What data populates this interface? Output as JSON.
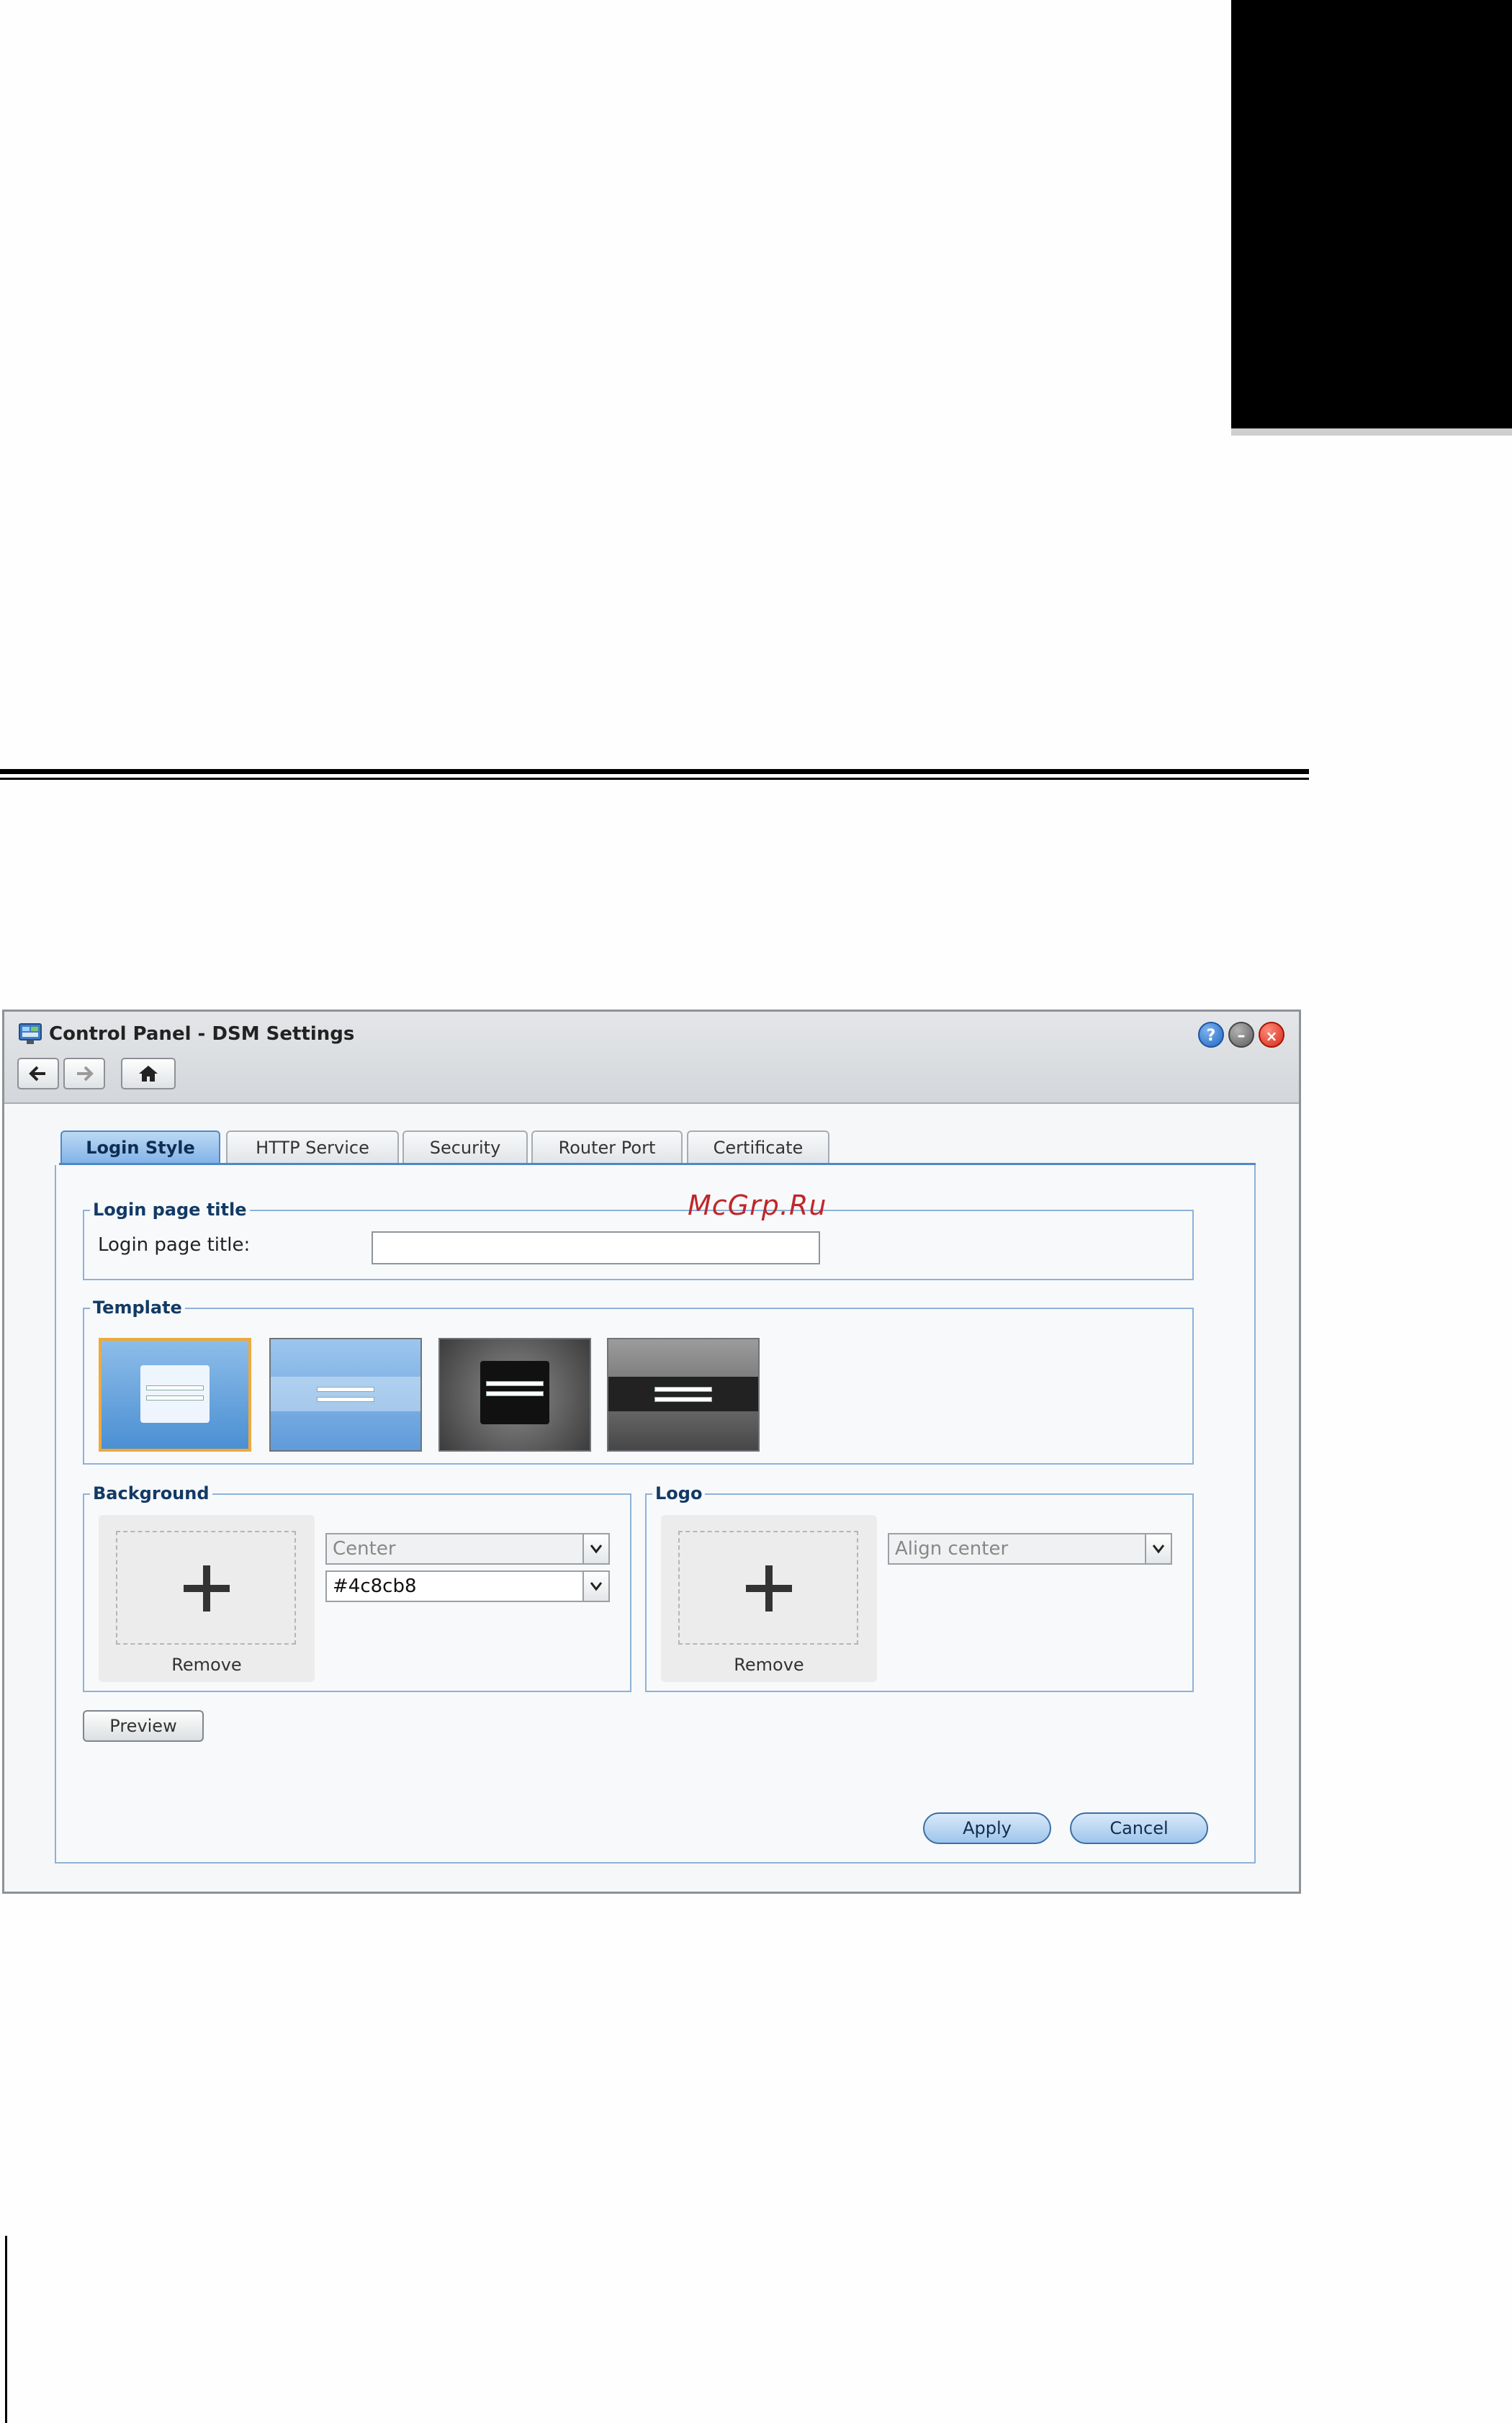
{
  "window": {
    "title": "Control Panel - DSM Settings",
    "controls": {
      "help": "?",
      "minimize": "–",
      "close": "×"
    }
  },
  "tabs": [
    {
      "label": "Login Style",
      "active": true
    },
    {
      "label": "HTTP Service",
      "active": false
    },
    {
      "label": "Security",
      "active": false
    },
    {
      "label": "Router Port",
      "active": false
    },
    {
      "label": "Certificate",
      "active": false
    }
  ],
  "watermark": "McGrp.Ru",
  "login_title": {
    "legend": "Login page title",
    "field_label": "Login page title:",
    "value": ""
  },
  "template": {
    "legend": "Template",
    "selected_index": 0
  },
  "background": {
    "legend": "Background",
    "remove_label": "Remove",
    "position_value": "Center",
    "color_value": "#4c8cb8"
  },
  "logo": {
    "legend": "Logo",
    "remove_label": "Remove",
    "align_value": "Align center"
  },
  "buttons": {
    "preview": "Preview",
    "apply": "Apply",
    "cancel": "Cancel"
  },
  "colors": {
    "accent": "#4e88c7",
    "selected_template_border": "#f0a93a",
    "watermark": "#c0262a"
  }
}
